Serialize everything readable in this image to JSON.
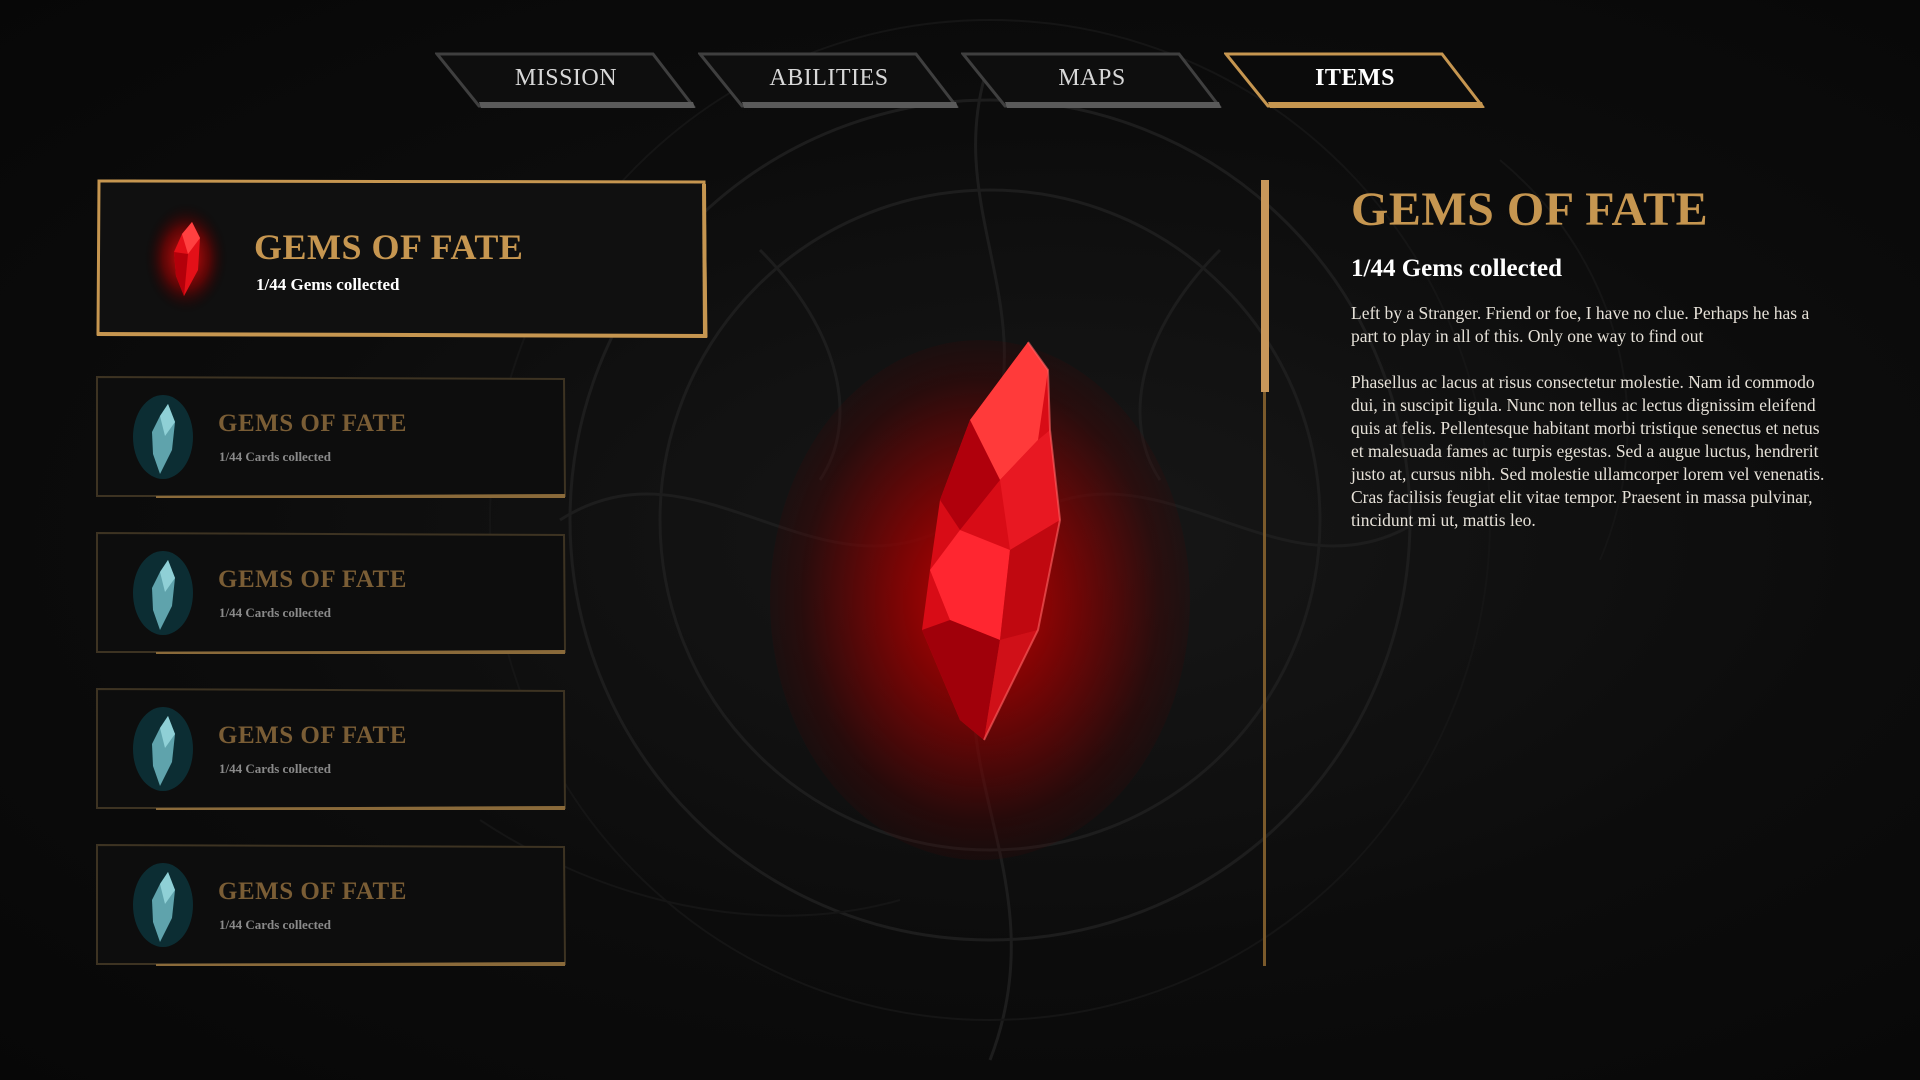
{
  "tabs": [
    {
      "label": "MISSION",
      "active": false
    },
    {
      "label": "ABILITIES",
      "active": false
    },
    {
      "label": "MAPS",
      "active": false
    },
    {
      "label": "ITEMS",
      "active": true
    }
  ],
  "items": [
    {
      "title": "GEMS OF FATE",
      "subtitle": "1/44 Gems collected",
      "gem_icon": "red-gem-icon",
      "selected": true
    },
    {
      "title": "GEMS OF FATE",
      "subtitle": "1/44 Cards collected",
      "gem_icon": "blue-gem-icon",
      "selected": false
    },
    {
      "title": "GEMS OF FATE",
      "subtitle": "1/44 Cards collected",
      "gem_icon": "blue-gem-icon",
      "selected": false
    },
    {
      "title": "GEMS OF FATE",
      "subtitle": "1/44 Cards collected",
      "gem_icon": "blue-gem-icon",
      "selected": false
    },
    {
      "title": "GEMS OF FATE",
      "subtitle": "1/44 Cards collected",
      "gem_icon": "blue-gem-icon",
      "selected": false
    }
  ],
  "detail": {
    "title": "GEMS OF FATE",
    "subtitle": "1/44 Gems collected",
    "paragraph_1": "Left by a Stranger. Friend or foe, I have no clue. Perhaps he has a part to play in all of this. Only one way to find out",
    "paragraph_2": "Phasellus ac lacus at risus consectetur molestie. Nam id commodo dui, in suscipit ligula. Nunc non tellus ac lectus dignissim eleifend quis at felis. Pellentesque habitant morbi tristique senectus et netus et malesuada fames ac turpis egestas. Sed a augue luctus, hendrerit justo at, cursus nibh. Sed molestie ullamcorper lorem vel venenatis. Cras facilisis feugiat elit vitae tempor. Praesent in massa pulvinar, tincidunt mi ut, mattis leo."
  },
  "showcase": {
    "gem_icon": "large-red-gem-icon"
  },
  "colors": {
    "accent_gold": "#c69650",
    "dim_gold": "#7a5d35",
    "gem_red": "#e0101a",
    "gem_blue": "#5fa3ac",
    "background": "#0c0c0c"
  }
}
